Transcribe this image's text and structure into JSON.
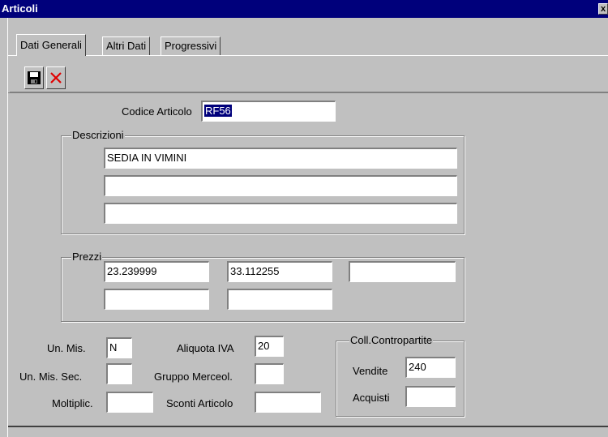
{
  "window": {
    "title": "Articoli",
    "close_label": "x"
  },
  "tabs": [
    "Dati Generali",
    "Altri Dati",
    "Progressivi"
  ],
  "toolbar": {
    "save_icon": "floppy-disk",
    "cancel_icon": "red-x"
  },
  "codice": {
    "label": "Codice Articolo",
    "value": "RF56"
  },
  "descrizioni": {
    "title": "Descrizioni",
    "lines": [
      "SEDIA IN VIMINI",
      "",
      ""
    ]
  },
  "prezzi": {
    "title": "Prezzi",
    "values": [
      "23.239999",
      "33.112255",
      "",
      "",
      ""
    ]
  },
  "un_mis": {
    "label": "Un. Mis.",
    "value": "N"
  },
  "un_mis_sec": {
    "label": "Un. Mis. Sec.",
    "value": ""
  },
  "moltiplic": {
    "label": "Moltiplic.",
    "value": ""
  },
  "aliquota_iva": {
    "label": "Aliquota IVA",
    "value": "20"
  },
  "gruppo_merceol": {
    "label": "Gruppo Merceol.",
    "value": ""
  },
  "sconti_articolo": {
    "label": "Sconti Articolo",
    "value": ""
  },
  "coll": {
    "title": "Coll.Contropartite",
    "vendite_label": "Vendite",
    "vendite_value": "240",
    "acquisti_label": "Acquisti",
    "acquisti_value": ""
  }
}
